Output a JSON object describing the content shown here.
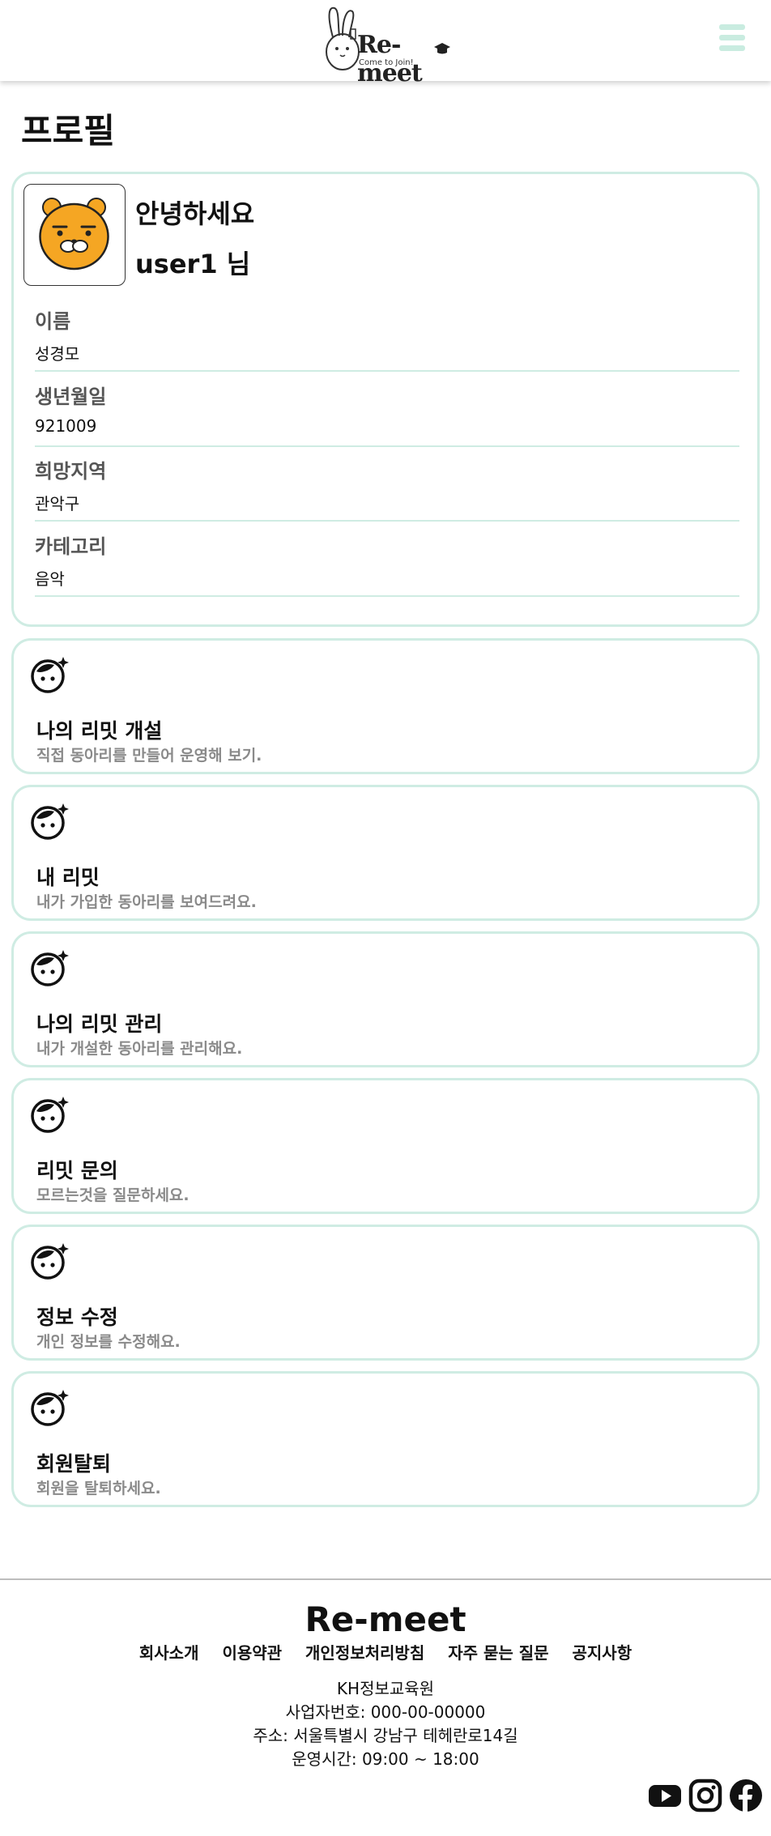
{
  "header": {
    "logo_text": "Re-meet",
    "logo_tagline": "Come to Join!",
    "menu_icon": "hamburger-icon"
  },
  "page": {
    "title": "프로필"
  },
  "profile": {
    "avatar_icon": "ryan-character-avatar",
    "greeting": "안녕하세요",
    "username": "user1 님",
    "fields": [
      {
        "label": "이름",
        "value": "성경모"
      },
      {
        "label": "생년월일",
        "value": "921009"
      },
      {
        "label": "희망지역",
        "value": "관악구"
      },
      {
        "label": "카테고리",
        "value": "음악"
      }
    ]
  },
  "menu": [
    {
      "icon": "smiley-sparkle-icon",
      "title": "나의 리밋 개설",
      "desc": "직접 동아리를 만들어 운영해 보기."
    },
    {
      "icon": "smiley-sparkle-icon",
      "title": "내 리밋",
      "desc": "내가 가입한 동아리를 보여드려요."
    },
    {
      "icon": "smiley-sparkle-icon",
      "title": "나의 리밋 관리",
      "desc": "내가 개설한 동아리를 관리해요."
    },
    {
      "icon": "smiley-sparkle-icon",
      "title": "리밋 문의",
      "desc": "모르는것을 질문하세요."
    },
    {
      "icon": "smiley-sparkle-icon",
      "title": "정보 수정",
      "desc": "개인 정보를 수정해요."
    },
    {
      "icon": "smiley-sparkle-icon",
      "title": "회원탈퇴",
      "desc": "회원을 탈퇴하세요."
    }
  ],
  "footer": {
    "brand": "Re-meet",
    "links": [
      "회사소개",
      "이용약관",
      "개인정보처리방침",
      "자주 묻는 질문",
      "공지사항"
    ],
    "company": "KH정보교육원",
    "business_number": "사업자번호: 000-00-00000",
    "address": "주소: 서울특별시 강남구 테헤란로14길",
    "hours": "운영시간: 09:00 ~ 18:00",
    "social_icons": [
      "youtube-icon",
      "instagram-icon",
      "facebook-icon"
    ]
  },
  "colors": {
    "accent_mint": "#cfece3",
    "hamburger": "#c9ece0",
    "avatar_face": "#f5a623",
    "muted_text": "#8a8a8a"
  }
}
